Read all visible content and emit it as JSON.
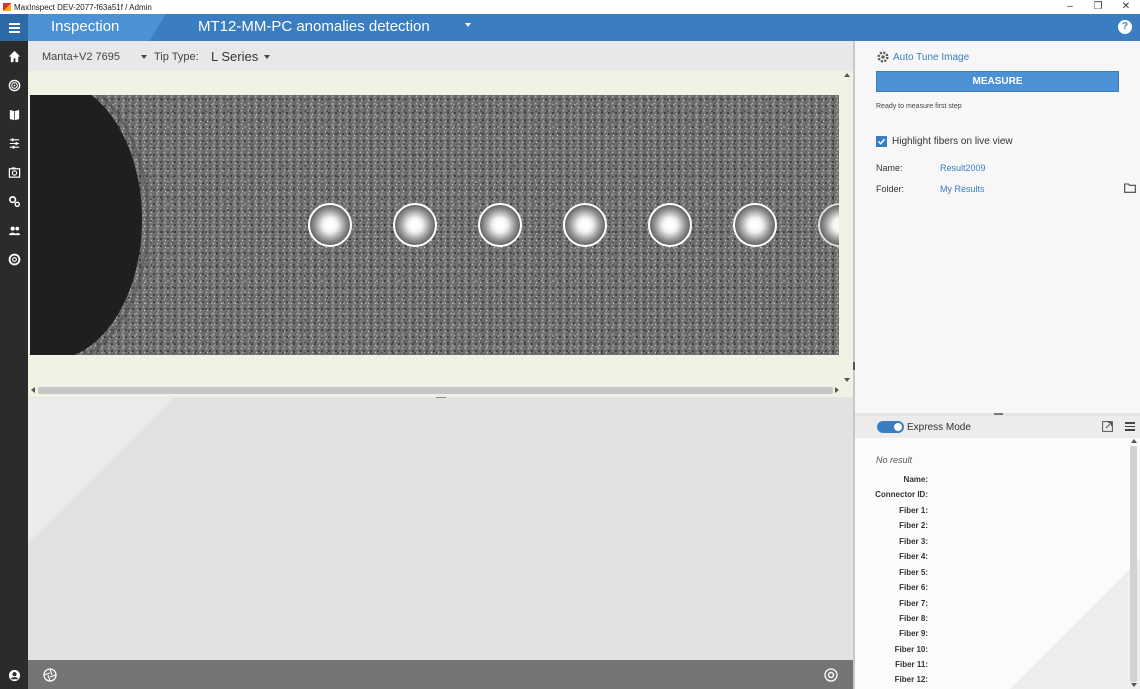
{
  "window": {
    "title": "MaxInspect DEV-2077-f63a51f / Admin",
    "minimize": "–",
    "restore": "❐",
    "close": "✕"
  },
  "header": {
    "module": "Inspection",
    "program": "MT12-MM-PC anomalies detection",
    "help": "?"
  },
  "sidebar": {
    "items": [
      {
        "name": "home-icon"
      },
      {
        "name": "target-icon"
      },
      {
        "name": "book-icon"
      },
      {
        "name": "sliders-icon"
      },
      {
        "name": "camera-icon"
      },
      {
        "name": "settings-icon"
      },
      {
        "name": "users-icon"
      },
      {
        "name": "lifebuoy-icon"
      }
    ],
    "bottom_icon": "user-icon"
  },
  "toolbar": {
    "device": "Manta+V2 7695",
    "tip_type_label": "Tip Type:",
    "tip_type_value": "L Series"
  },
  "right_panel": {
    "auto_tune_label": "Auto Tune Image",
    "measure_label": "MEASURE",
    "measure_status": "Ready to measure first step",
    "highlight_label": "Highlight fibers on live view",
    "highlight_checked": true,
    "name_label": "Name:",
    "name_value": "Result2009",
    "folder_label": "Folder:",
    "folder_value": "My Results"
  },
  "express": {
    "label": "Express Mode",
    "enabled": true
  },
  "results": {
    "empty_text": "No result",
    "fields": [
      {
        "label": "Name:"
      },
      {
        "label": "Connector ID:"
      },
      {
        "label": "Fiber 1:"
      },
      {
        "label": "Fiber 2:"
      },
      {
        "label": "Fiber 3:"
      },
      {
        "label": "Fiber 4:"
      },
      {
        "label": "Fiber 5:"
      },
      {
        "label": "Fiber 6:"
      },
      {
        "label": "Fiber 7:"
      },
      {
        "label": "Fiber 8:"
      },
      {
        "label": "Fiber 9:"
      },
      {
        "label": "Fiber 10:"
      },
      {
        "label": "Fiber 11:"
      },
      {
        "label": "Fiber 12:"
      }
    ]
  },
  "colors": {
    "accent": "#3a7ec1",
    "sidebar": "#2b2b2b",
    "liveview_bg": "#f1f1e4"
  }
}
